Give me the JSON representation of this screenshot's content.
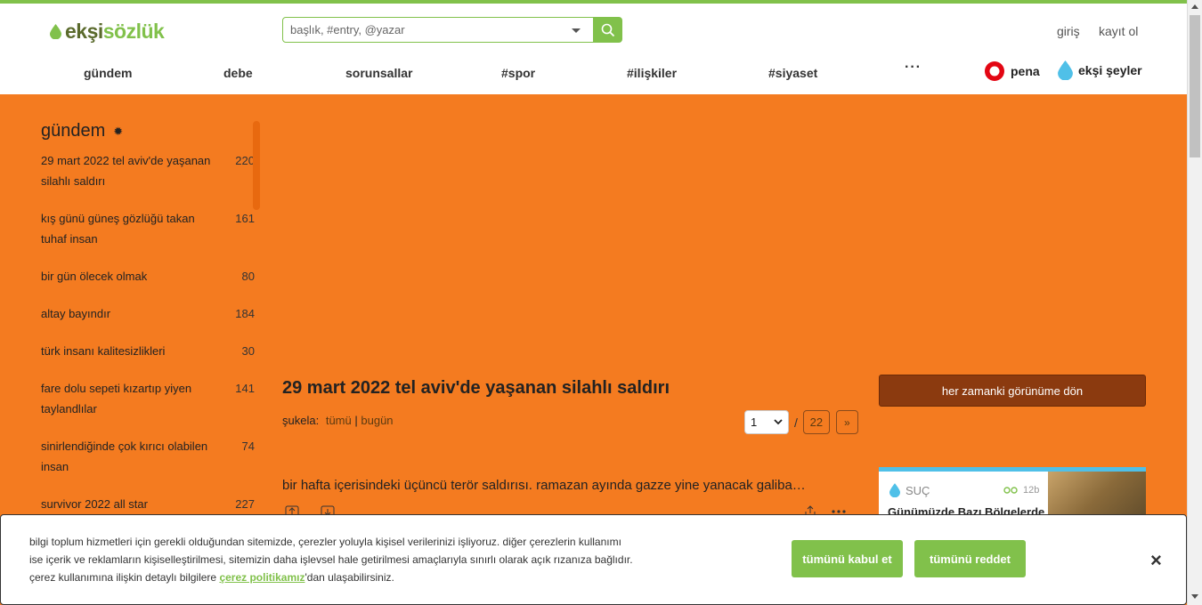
{
  "header": {
    "logo_part1": "ekşi",
    "logo_part2": "sözlük",
    "search_placeholder": "başlık, #entry, @yazar",
    "login": "giriş",
    "register": "kayıt ol",
    "nav": [
      "gündem",
      "debe",
      "sorunsallar",
      "#spor",
      "#ilişkiler",
      "#siyaset"
    ],
    "nav_more": "···",
    "pena": "pena",
    "seyler": "ekşi şeyler"
  },
  "sidebar": {
    "title": "gündem",
    "topics": [
      {
        "title": "29 mart 2022 tel aviv'de yaşanan silahlı saldırı",
        "count": "220"
      },
      {
        "title": "kış günü güneş gözlüğü takan tuhaf insan",
        "count": "161"
      },
      {
        "title": "bir gün ölecek olmak",
        "count": "80"
      },
      {
        "title": "altay bayındır",
        "count": "184"
      },
      {
        "title": "türk insanı kalitesizlikleri",
        "count": "30"
      },
      {
        "title": "fare dolu sepeti kızartıp yiyen taylandlılar",
        "count": "141"
      },
      {
        "title": "sinirlendiğinde çok kırıcı olabilen insan",
        "count": "74"
      },
      {
        "title": "survivor 2022 all star",
        "count": "227"
      }
    ]
  },
  "main": {
    "title": "29 mart 2022 tel aviv'de yaşanan silahlı saldırı",
    "sukela_label": "şukela:",
    "sukela_all": "tümü",
    "sukela_sep": "|",
    "sukela_today": "bugün",
    "page_current": "1",
    "page_sep": "/",
    "page_total": "22",
    "page_next": "»",
    "entry_text": "bir hafta içerisindeki üçüncü terör saldırısı. ramazan ayında gazze yine yanacak galiba…"
  },
  "right": {
    "her_zamanki_button": "her zamanki görünüme dön",
    "card_category": "SUÇ",
    "card_time": "12b",
    "card_title": "Günümüzde Bazı Bölgelerde"
  },
  "cookie": {
    "text_line1": "bilgi toplum hizmetleri için gerekli olduğundan sitemizde, çerezler yoluyla kişisel verilerinizi işliyoruz. diğer çerezlerin kullanımı",
    "text_line2": "ise içerik ve reklamların kişiselleştirilmesi, sitemizin daha işlevsel hale getirilmesi amaçlarıyla sınırlı olarak açık rızanıza bağlıdır.",
    "text_line3_pre": "çerez kullanımına ilişkin detaylı bilgilere ",
    "text_link": "çerez politikamız",
    "text_line3_post": "'dan ulaşabilirsiniz.",
    "accept": "tümünü kabul et",
    "reject": "tümünü reddet",
    "close": "×"
  },
  "colors": {
    "accent_green": "#81c14b",
    "page_orange": "#f47b20",
    "button_brown": "#8b3a0f",
    "card_blue": "#4fc0e8"
  }
}
